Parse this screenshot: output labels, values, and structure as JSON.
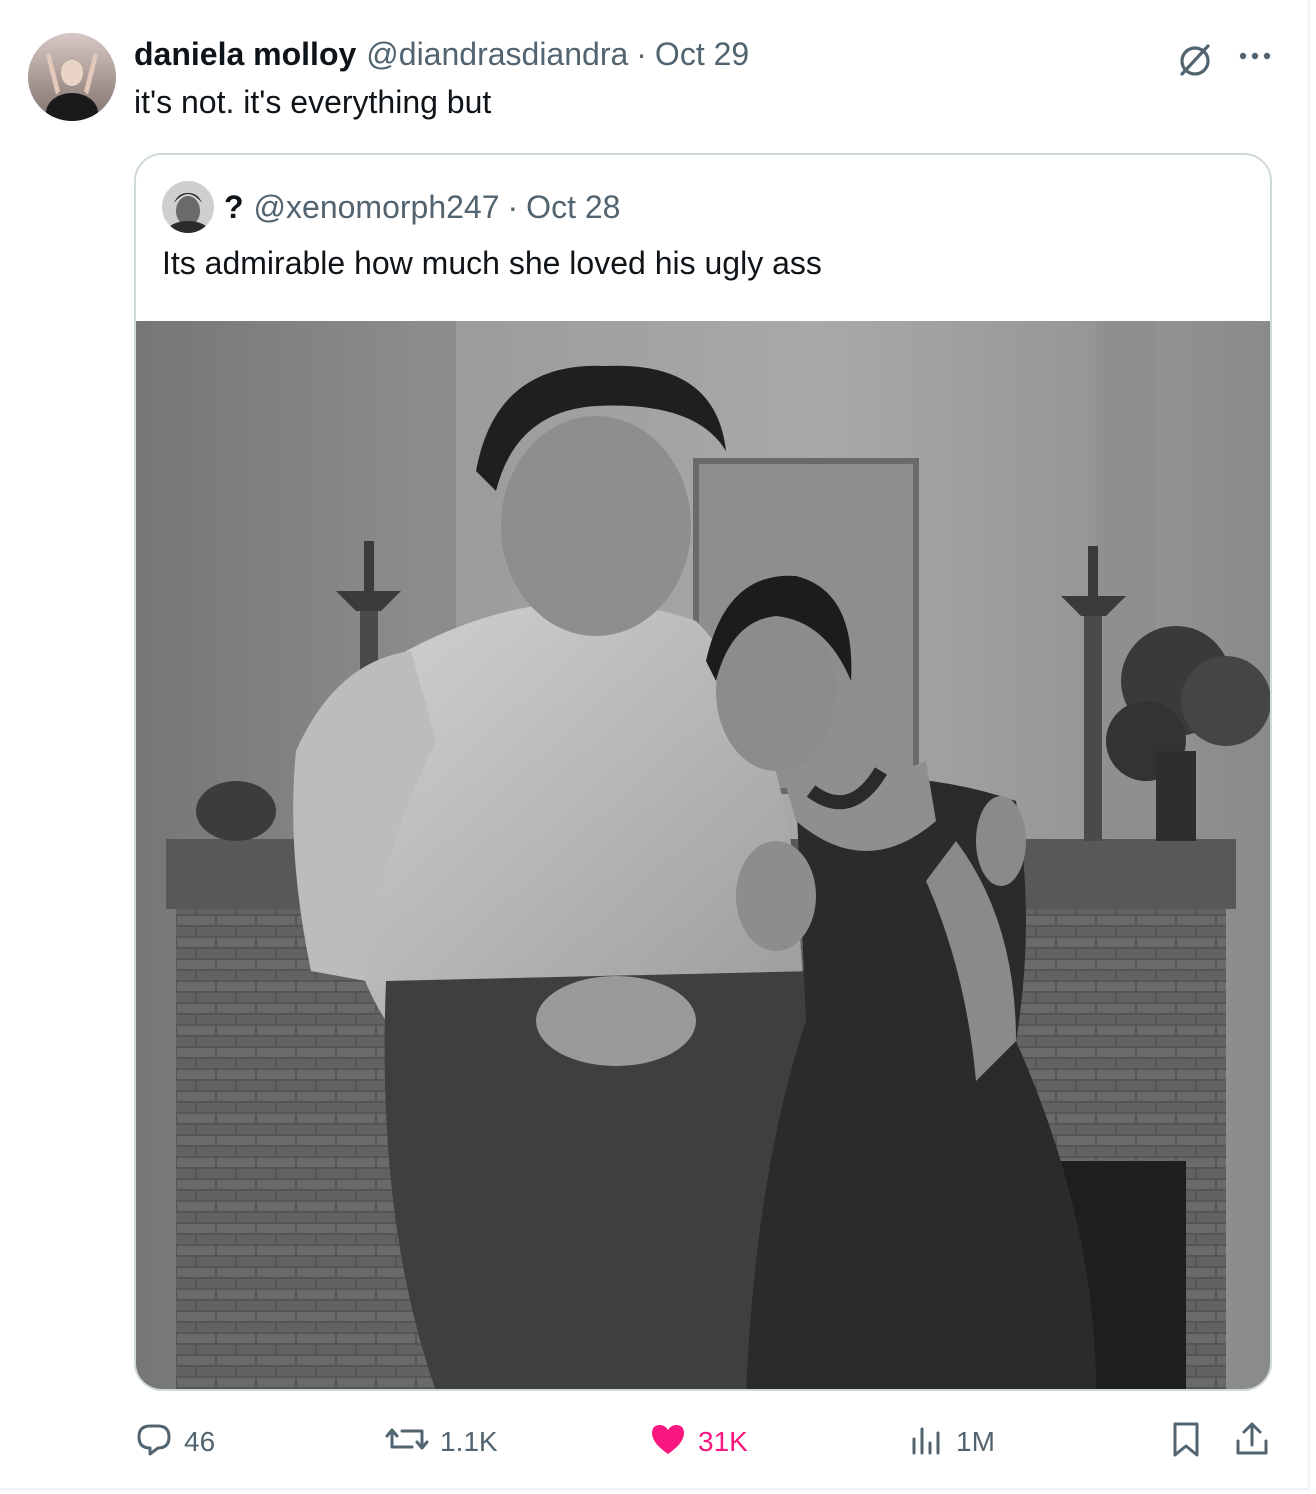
{
  "tweet": {
    "author_name": "daniela molloy",
    "author_handle": "@diandrasdiandra",
    "separator": "·",
    "date": "Oct 29",
    "text": "it's not. it's everything but"
  },
  "quoted_tweet": {
    "author_name": "?",
    "author_handle": "@xenomorph247",
    "separator": "·",
    "date": "Oct 28",
    "text": "Its admirable how much she loved his ugly ass",
    "media_icon": "photo"
  },
  "actions": {
    "replies": "46",
    "reposts": "1.1K",
    "likes": "31K",
    "views": "1M",
    "like_color": "#f91880",
    "muted_color": "#536471"
  },
  "icons": {
    "grok": "grok-icon",
    "more": "more-icon",
    "reply": "reply-icon",
    "repost": "repost-icon",
    "like": "heart-icon",
    "views": "views-icon",
    "bookmark": "bookmark-icon",
    "share": "share-icon"
  }
}
